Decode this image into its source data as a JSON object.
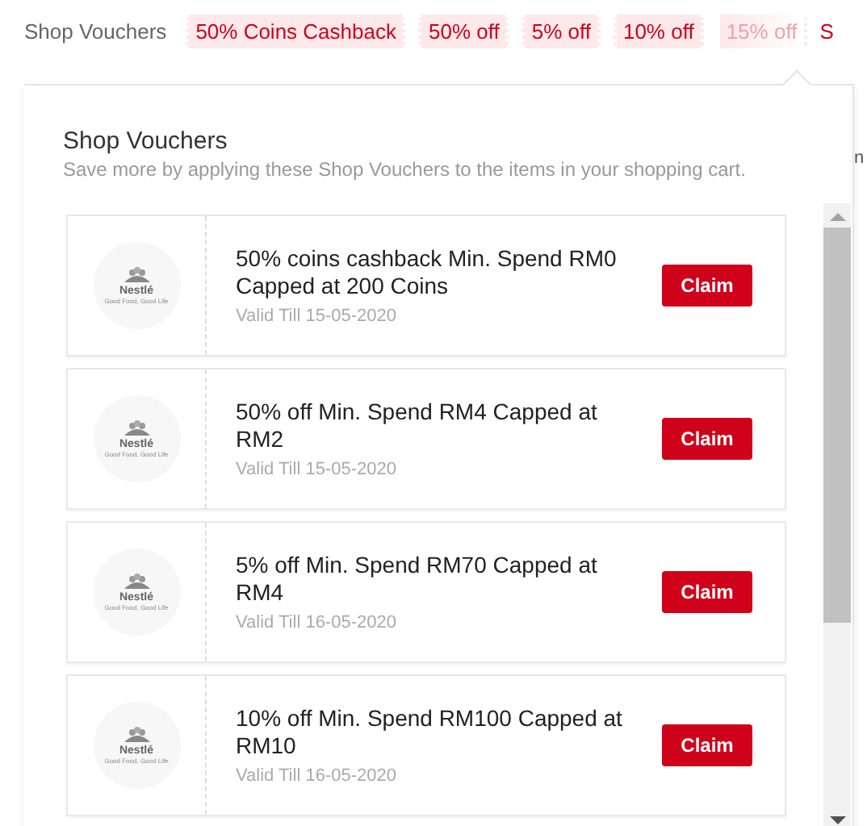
{
  "voucher_bar": {
    "label": "Shop Vouchers",
    "tags": [
      {
        "text": "50% Coins Cashback",
        "faded": false
      },
      {
        "text": "50% off",
        "faded": false
      },
      {
        "text": "5% off",
        "faded": false
      },
      {
        "text": "10% off",
        "faded": false
      },
      {
        "text": "15% off",
        "faded": true
      }
    ],
    "cut_text": "S"
  },
  "side_text": "n",
  "popup": {
    "title": "Shop Vouchers",
    "subtitle": "Save more by applying these Shop Vouchers to the items in your shopping cart.",
    "vouchers": [
      {
        "logo": "Nestlé",
        "tagline": "Good Food, Good Life",
        "description": "50% coins cashback Min. Spend RM0 Capped at 200 Coins",
        "validity": "Valid Till 15-05-2020",
        "button": "Claim"
      },
      {
        "logo": "Nestlé",
        "tagline": "Good Food, Good Life",
        "description": "50% off Min. Spend RM4 Capped at RM2",
        "validity": "Valid Till 15-05-2020",
        "button": "Claim"
      },
      {
        "logo": "Nestlé",
        "tagline": "Good Food, Good Life",
        "description": "5% off Min. Spend RM70 Capped at RM4",
        "validity": "Valid Till 16-05-2020",
        "button": "Claim"
      },
      {
        "logo": "Nestlé",
        "tagline": "Good Food, Good Life",
        "description": "10% off Min. Spend RM100 Capped at RM10",
        "validity": "Valid Till 16-05-2020",
        "button": "Claim"
      }
    ]
  }
}
